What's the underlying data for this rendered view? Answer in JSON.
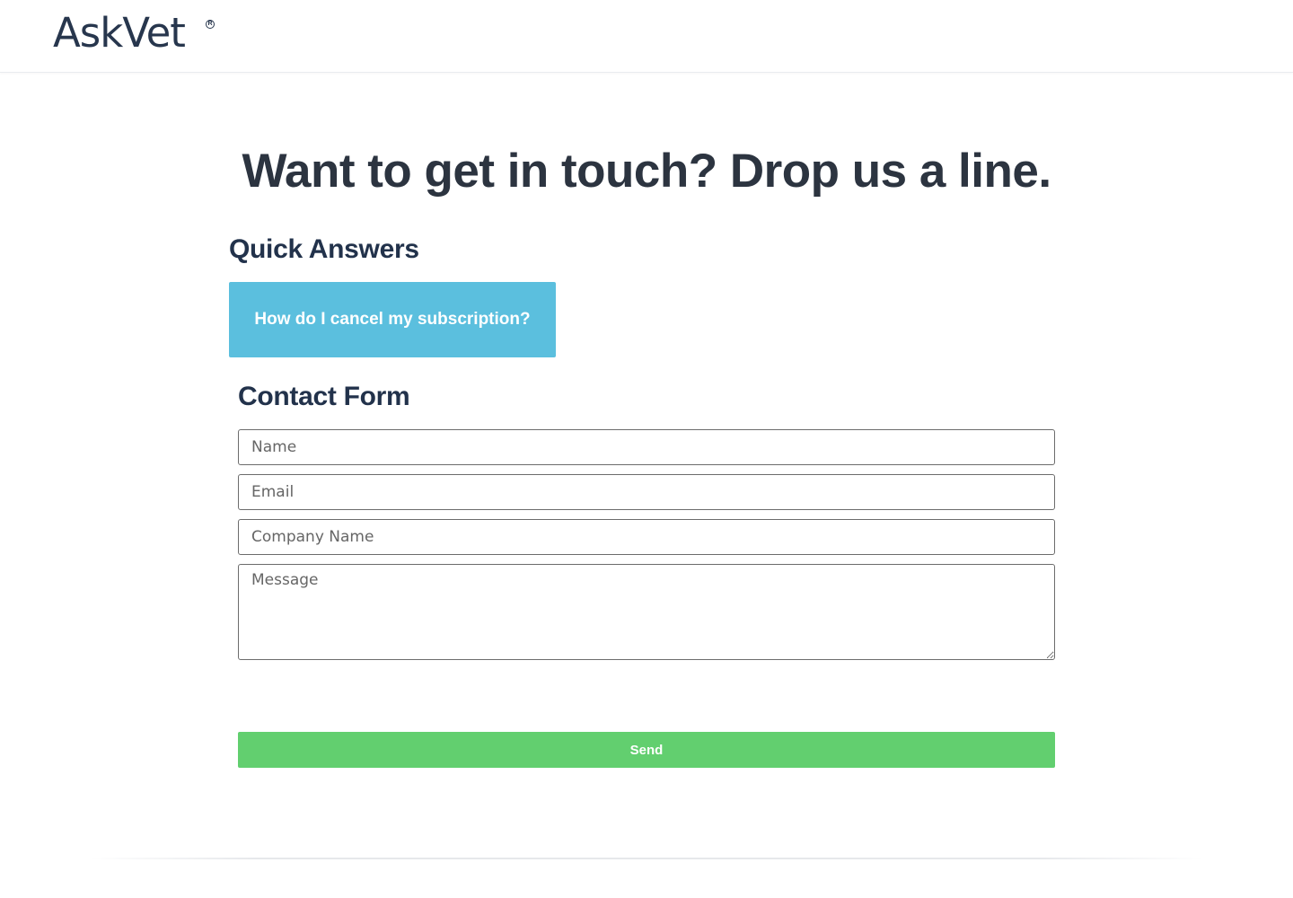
{
  "brand": {
    "logo_text": "AskVet",
    "registered_mark": "R"
  },
  "hero": {
    "title": "Want to get in touch? Drop us a line."
  },
  "quick_answers": {
    "title": "Quick Answers",
    "items": [
      {
        "label": "How do I cancel my subscription?"
      }
    ]
  },
  "contact_form": {
    "title": "Contact Form",
    "fields": {
      "name_placeholder": "Name",
      "email_placeholder": "Email",
      "company_placeholder": "Company Name",
      "message_placeholder": "Message"
    },
    "submit_label": "Send"
  },
  "colors": {
    "brand_navy": "#27364d",
    "quick_answer_button": "#5bbfde",
    "send_button": "#62cf6f",
    "heading_dark": "#2c3440"
  }
}
